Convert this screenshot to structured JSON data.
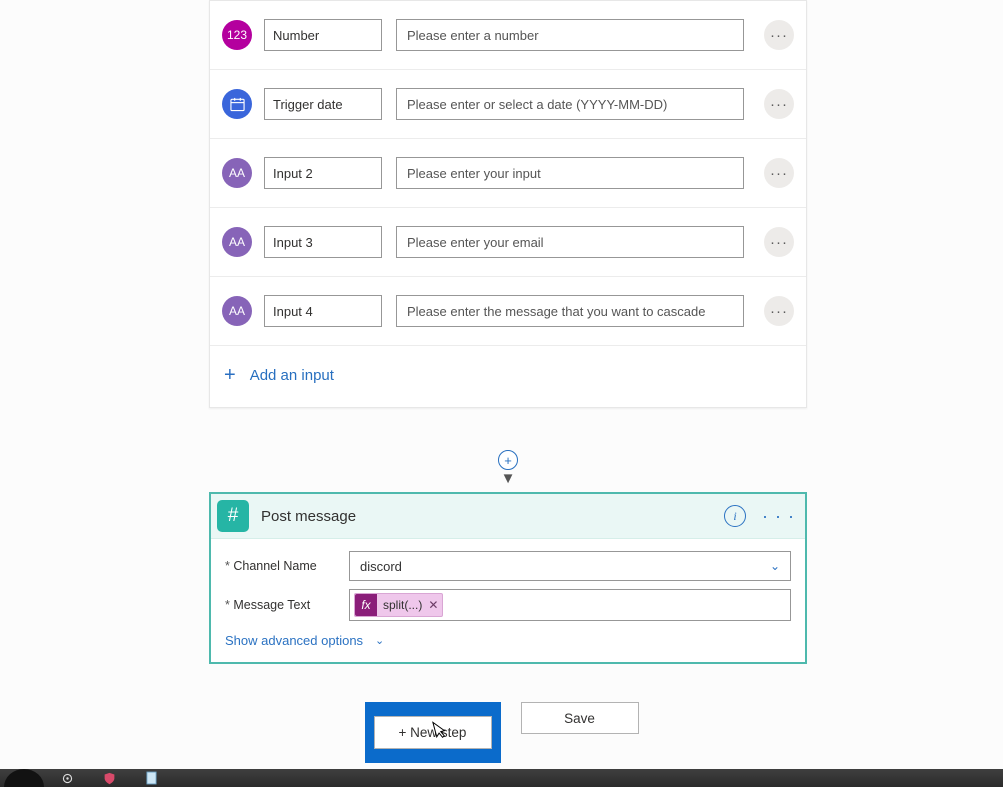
{
  "trigger": {
    "inputs": [
      {
        "icon": "num",
        "icon_text": "123",
        "name": "Number",
        "desc": "Please enter a number"
      },
      {
        "icon": "date",
        "icon_text": "",
        "name": "Trigger date",
        "desc": "Please enter or select a date (YYYY-MM-DD)"
      },
      {
        "icon": "text",
        "icon_text": "AA",
        "name": "Input 2",
        "desc": "Please enter your input"
      },
      {
        "icon": "text",
        "icon_text": "AA",
        "name": "Input 3",
        "desc": "Please enter your email"
      },
      {
        "icon": "text",
        "icon_text": "AA",
        "name": "Input 4",
        "desc": "Please enter the message that you want to cascade"
      }
    ],
    "add_label": "Add an input"
  },
  "action": {
    "title": "Post message",
    "fields": {
      "channel_label": "Channel Name",
      "channel_value": "discord",
      "message_label": "Message Text",
      "token_text": "split(...)"
    },
    "advanced_label": "Show advanced options"
  },
  "footer": {
    "new_step": "+ New step",
    "save": "Save"
  }
}
